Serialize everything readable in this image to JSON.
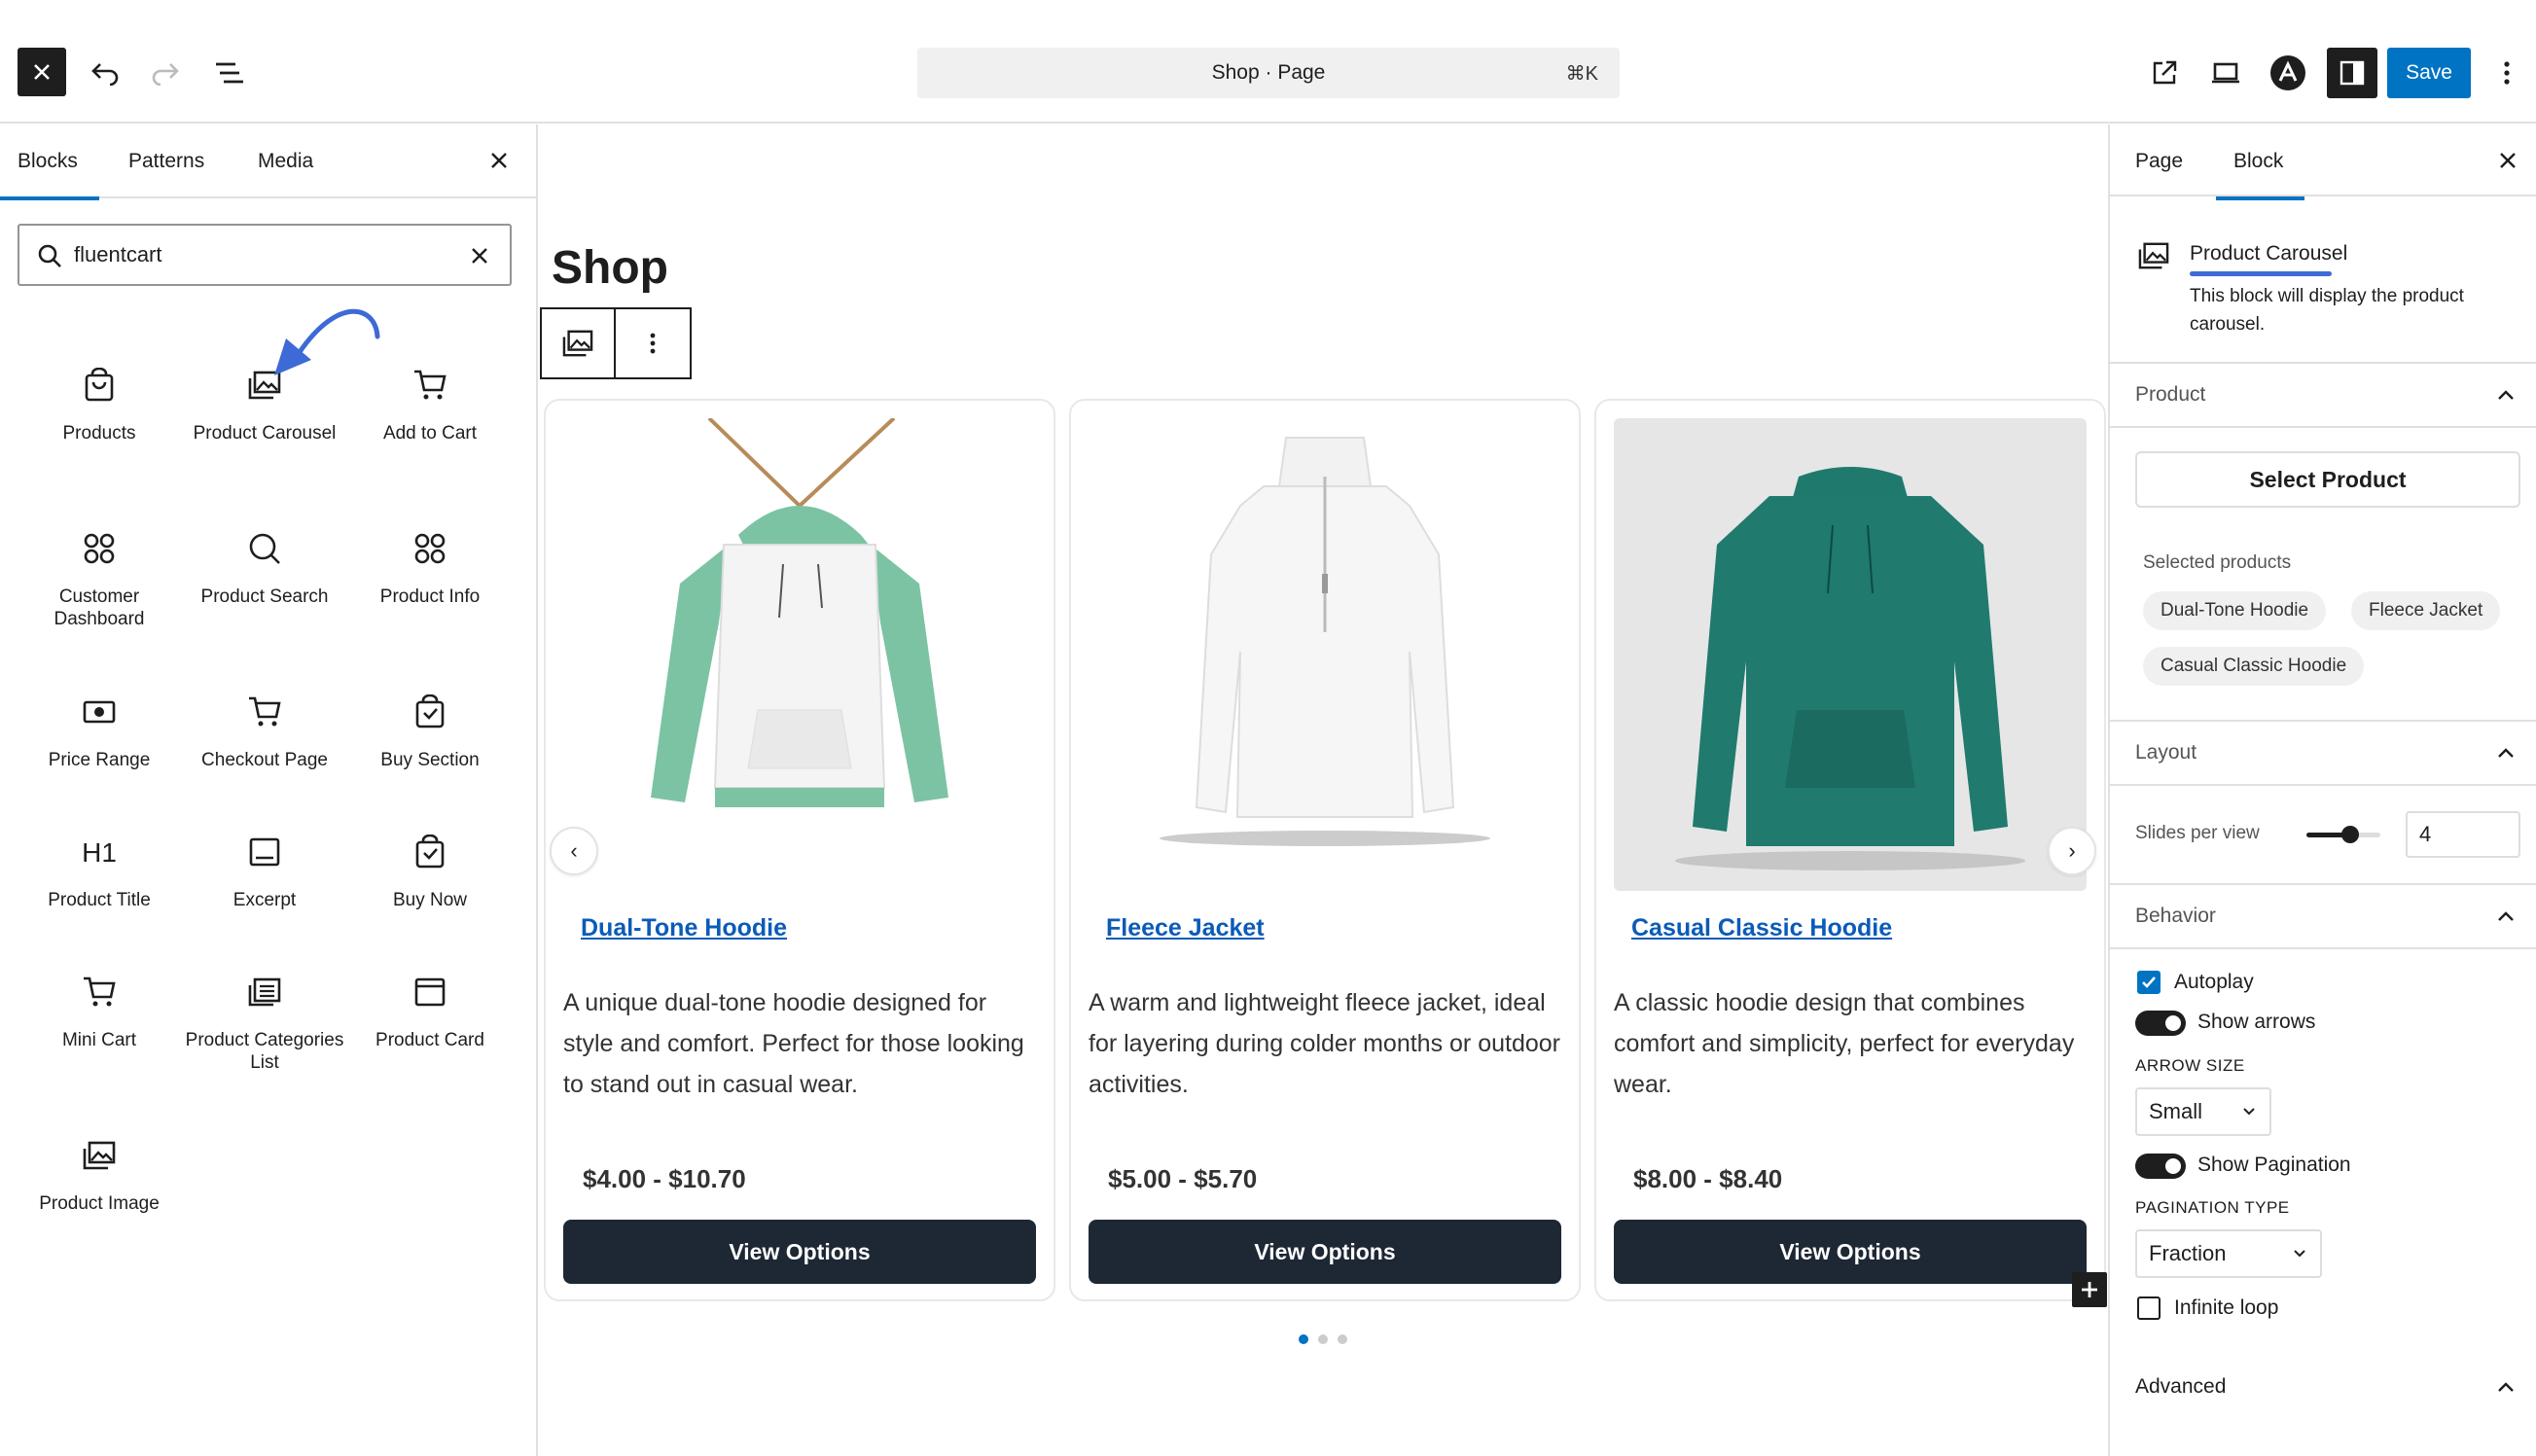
{
  "topbar": {
    "command_text": "Shop · Page",
    "command_shortcut": "⌘K",
    "save_label": "Save"
  },
  "inserter": {
    "tabs": [
      {
        "label": "Blocks",
        "active": true
      },
      {
        "label": "Patterns",
        "active": false
      },
      {
        "label": "Media",
        "active": false
      }
    ],
    "search": {
      "value": "fluentcart"
    },
    "blocks": [
      {
        "label": "Products",
        "icon": "bag-icon"
      },
      {
        "label": "Product Carousel",
        "icon": "gallery-icon"
      },
      {
        "label": "Add to Cart",
        "icon": "cart-icon"
      },
      {
        "label": "Customer Dashboard",
        "icon": "grid-circles-icon"
      },
      {
        "label": "Product Search",
        "icon": "search-icon"
      },
      {
        "label": "Product Info",
        "icon": "grid-circles-icon"
      },
      {
        "label": "Price Range",
        "icon": "money-icon"
      },
      {
        "label": "Checkout Page",
        "icon": "cart-icon"
      },
      {
        "label": "Buy Section",
        "icon": "bag-icon"
      },
      {
        "label": "Product Title",
        "icon": "heading-icon"
      },
      {
        "label": "Excerpt",
        "icon": "excerpt-icon"
      },
      {
        "label": "Buy Now",
        "icon": "bag-icon"
      },
      {
        "label": "Mini Cart",
        "icon": "cart-icon"
      },
      {
        "label": "Product Categories List",
        "icon": "list-box-icon"
      },
      {
        "label": "Product Card",
        "icon": "card-icon"
      },
      {
        "label": "Product Image",
        "icon": "gallery-icon"
      }
    ],
    "heading_icon_text": "H1"
  },
  "canvas": {
    "page_title": "Shop",
    "products": [
      {
        "title": "Dual-Tone Hoodie",
        "description": "A unique dual-tone hoodie designed for style and comfort. Perfect for those looking to stand out in casual wear.",
        "price": "$4.00 - $10.70",
        "button": "View Options"
      },
      {
        "title": "Fleece Jacket",
        "description": "A warm and lightweight fleece jacket, ideal for layering during colder months or outdoor activities.",
        "price": "$5.00 - $5.70",
        "button": "View Options"
      },
      {
        "title": "Casual Classic Hoodie",
        "description": "A classic hoodie design that combines comfort and simplicity, perfect for everyday wear.",
        "price": "$8.00 - $8.40",
        "button": "View Options"
      }
    ],
    "prev_arrow": "‹",
    "next_arrow": "›"
  },
  "settings": {
    "tabs": [
      {
        "label": "Page",
        "active": false
      },
      {
        "label": "Block",
        "active": true
      }
    ],
    "block_name": "Product Carousel",
    "block_description": "This block will display the product carousel.",
    "product_section": {
      "title": "Product",
      "select_button": "Select Product",
      "selected_label": "Selected products",
      "selected": [
        "Dual-Tone Hoodie",
        "Fleece Jacket",
        "Casual Classic Hoodie"
      ]
    },
    "layout_section": {
      "title": "Layout",
      "slides_label": "Slides per view",
      "slides_value": "4"
    },
    "behavior_section": {
      "title": "Behavior",
      "autoplay_label": "Autoplay",
      "autoplay_checked": true,
      "show_arrows_label": "Show arrows",
      "arrow_size_label": "ARROW SIZE",
      "arrow_size_value": "Small",
      "show_pagination_label": "Show Pagination",
      "pagination_type_label": "PAGINATION TYPE",
      "pagination_type_value": "Fraction",
      "infinite_loop_label": "Infinite loop",
      "infinite_loop_checked": false
    },
    "advanced_section": {
      "title": "Advanced"
    }
  },
  "colors": {
    "accent": "#0073c3",
    "dark": "#1e1e1e",
    "product_link": "#0b5bb8",
    "button_bg": "#1e2734"
  }
}
